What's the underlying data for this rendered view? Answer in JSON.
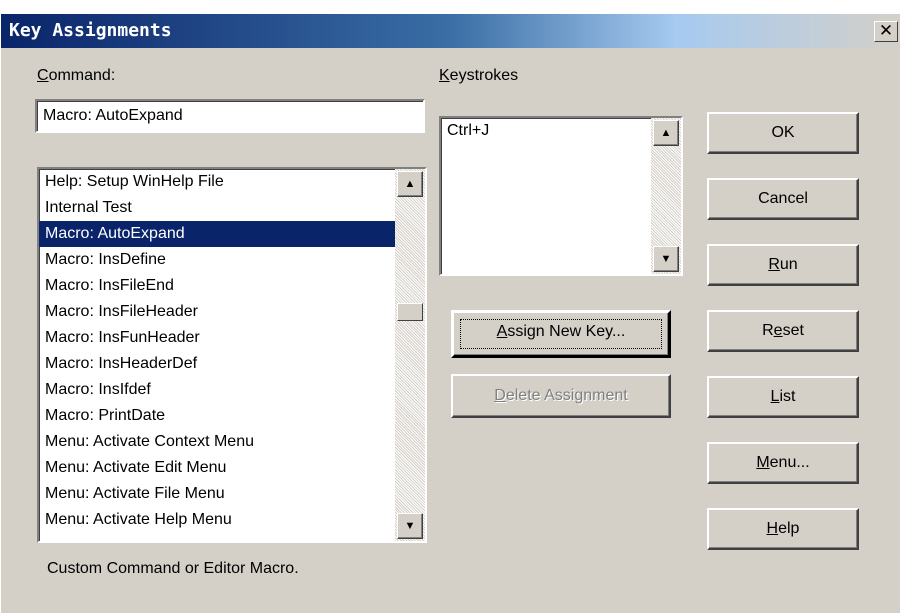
{
  "window": {
    "title": "Key Assignments",
    "close_glyph": "✕"
  },
  "command": {
    "label_accel": "C",
    "label_rest": "ommand:",
    "value": "Macro: AutoExpand"
  },
  "command_list": {
    "items": [
      "Help: Setup WinHelp File",
      "Internal Test",
      "Macro: AutoExpand",
      "Macro: InsDefine",
      "Macro: InsFileEnd",
      "Macro: InsFileHeader",
      "Macro: InsFunHeader",
      "Macro: InsHeaderDef",
      "Macro: InsIfdef",
      "Macro: PrintDate",
      "Menu: Activate Context Menu",
      "Menu: Activate Edit Menu",
      "Menu: Activate File Menu",
      "Menu: Activate Help Menu"
    ],
    "selected_index": 2
  },
  "keystrokes": {
    "label_accel": "K",
    "label_rest": "eystrokes",
    "items": [
      "Ctrl+J"
    ]
  },
  "buttons": {
    "ok": "OK",
    "cancel": "Cancel",
    "run_accel": "R",
    "run_rest": "un",
    "reset_pre": "R",
    "reset_accel": "e",
    "reset_rest": "set",
    "list_accel": "L",
    "list_rest": "ist",
    "menu_accel": "M",
    "menu_rest": "enu...",
    "help_accel": "H",
    "help_rest": "elp",
    "assign_accel": "A",
    "assign_rest": "ssign New Key...",
    "delete_accel": "D",
    "delete_rest": "elete Assignment"
  },
  "status_text": "Custom Command or Editor Macro.",
  "icons": {
    "scroll_up": "▲",
    "scroll_down": "▼"
  },
  "colors": {
    "dialog_face": "#d4d0c8",
    "title_bar_start": "#0a246a",
    "selection": "#0a246a"
  }
}
